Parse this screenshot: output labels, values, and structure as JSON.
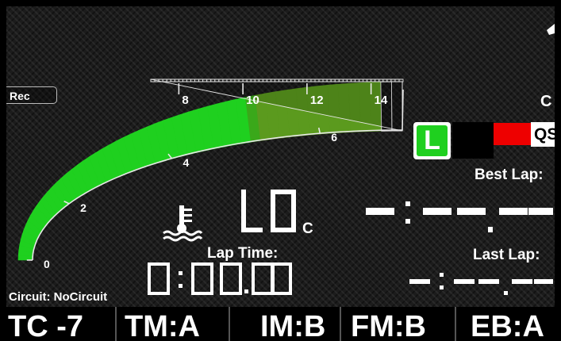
{
  "record_tab": "Rec",
  "rpm_gauge": {
    "max_value": 15,
    "level": 6.8,
    "tick_labels": [
      "0",
      "2",
      "4",
      "6",
      "8",
      "10",
      "12",
      "14"
    ],
    "fill_color": "#1fd01f"
  },
  "gear": {
    "unit": "C"
  },
  "flags": {
    "l_label": "L",
    "qs_label": "QS",
    "green": "#1fd01f",
    "red": "#ee0000"
  },
  "best_lap": {
    "label": "Best Lap:",
    "value": "-:--.--"
  },
  "last_lap": {
    "label": "Last Lap:",
    "value": "-:--.--"
  },
  "temperature": {
    "icon": "coolant-temperature-icon",
    "value": "LO",
    "unit": "C"
  },
  "lap_time": {
    "label": "Lap Time:",
    "value": "0:00.00"
  },
  "circuit": "Circuit: NoCircuit",
  "modes": [
    "TC -7",
    "TM:A",
    "IM:B",
    "FM:B",
    "EB:A"
  ]
}
